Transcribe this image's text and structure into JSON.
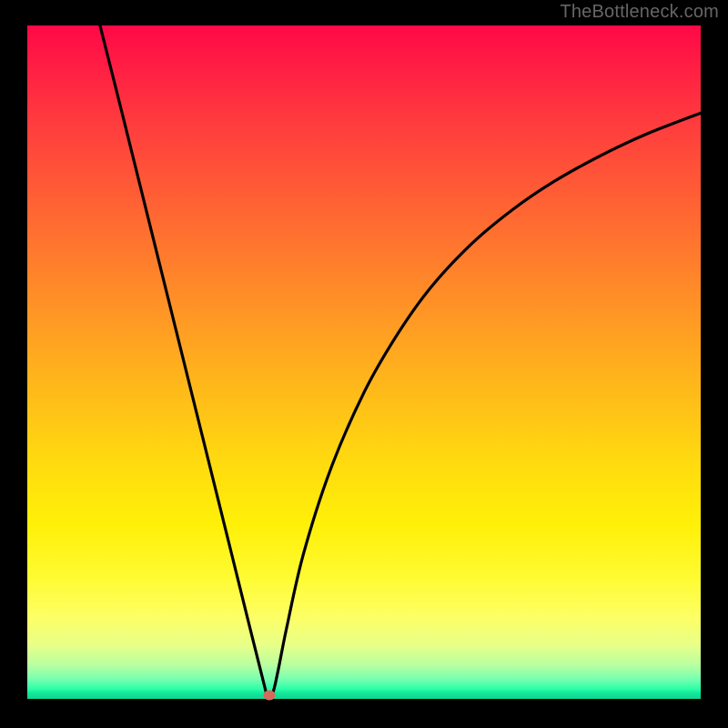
{
  "watermark": "TheBottleneck.com",
  "colors": {
    "frame": "#000000",
    "curve_stroke": "#000000",
    "marker_fill": "#d46a5a"
  },
  "chart_data": {
    "type": "line",
    "title": "",
    "xlabel": "",
    "ylabel": "",
    "xlim": [
      0,
      100
    ],
    "ylim": [
      0,
      100
    ],
    "series": [
      {
        "name": "deviation-curve",
        "description": "V-shaped bottleneck deviation curve. Left arm descends steeply and nearly linearly from the top edge into a sharp minimum near x≈35; right arm rises with a concave (square-root-like) profile approaching the upper-right.",
        "points": [
          {
            "x": 10.8,
            "y": 100
          },
          {
            "x": 14,
            "y": 87.3
          },
          {
            "x": 18,
            "y": 71.2
          },
          {
            "x": 22,
            "y": 55.1
          },
          {
            "x": 26,
            "y": 39.0
          },
          {
            "x": 30,
            "y": 22.9
          },
          {
            "x": 33,
            "y": 10.8
          },
          {
            "x": 34.7,
            "y": 4.0
          },
          {
            "x": 35.5,
            "y": 0.8
          },
          {
            "x": 36.4,
            "y": 0.8
          },
          {
            "x": 37.2,
            "y": 4.0
          },
          {
            "x": 38.5,
            "y": 10.5
          },
          {
            "x": 41,
            "y": 21.5
          },
          {
            "x": 45,
            "y": 34.0
          },
          {
            "x": 50,
            "y": 45.5
          },
          {
            "x": 55,
            "y": 54.2
          },
          {
            "x": 60,
            "y": 61.2
          },
          {
            "x": 66,
            "y": 67.6
          },
          {
            "x": 72,
            "y": 72.6
          },
          {
            "x": 78,
            "y": 76.7
          },
          {
            "x": 85,
            "y": 80.6
          },
          {
            "x": 92,
            "y": 83.9
          },
          {
            "x": 100,
            "y": 87.0
          }
        ]
      }
    ],
    "marker": {
      "name": "optimal-point",
      "x": 35.9,
      "y": 0.6
    },
    "background_gradient": {
      "description": "Vertical rainbow gradient mapping severity: red (high) at top through orange and yellow to a thin green band (optimal) at the very bottom.",
      "direction": "top-to-bottom",
      "stops": [
        {
          "pos": 0.0,
          "color": "#ff0846"
        },
        {
          "pos": 0.24,
          "color": "#ff5a36"
        },
        {
          "pos": 0.54,
          "color": "#ffb91a"
        },
        {
          "pos": 0.82,
          "color": "#fffb32"
        },
        {
          "pos": 0.95,
          "color": "#b8ffa0"
        },
        {
          "pos": 1.0,
          "color": "#0fd592"
        }
      ]
    }
  }
}
